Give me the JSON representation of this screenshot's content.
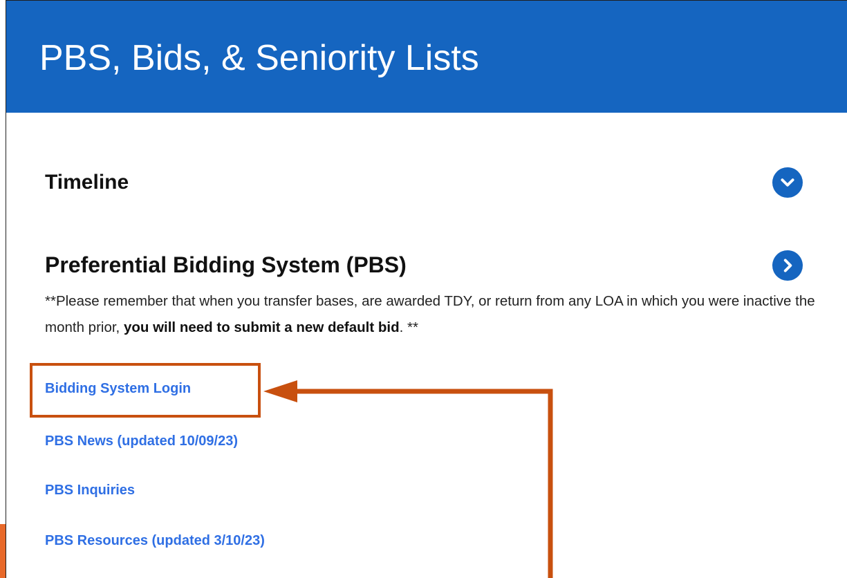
{
  "header": {
    "title": "PBS, Bids, & Seniority Lists"
  },
  "sections": {
    "timeline": {
      "title": "Timeline",
      "toggle_icon": "chevron-down-icon",
      "state": "collapsed"
    },
    "pbs": {
      "title": "Preferential Bidding System (PBS)",
      "toggle_icon": "chevron-right-icon",
      "state": "expanded",
      "notice": {
        "prefix": "**Please remember that when you transfer bases, are awarded TDY, or return from any LOA in which you were inactive the month prior, ",
        "emphasis": "you will need to submit a new default bid",
        "suffix": ". **"
      },
      "links": {
        "login": "Bidding System Login",
        "news": "PBS News (updated 10/09/23)",
        "inquiries": "PBS Inquiries",
        "resources": "PBS Resources (updated 3/10/23)"
      }
    }
  },
  "annotation": {
    "target": "Bidding System Login",
    "color": "#c8500f"
  },
  "colors": {
    "header_blue": "#1565c0",
    "link_blue": "#2f6fe4",
    "annotation_orange": "#c8500f"
  }
}
